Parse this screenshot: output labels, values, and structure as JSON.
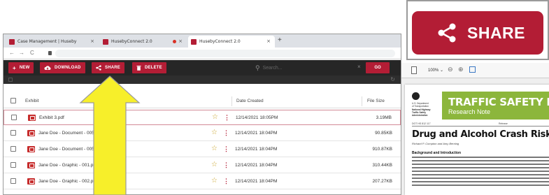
{
  "browser": {
    "tabs": [
      {
        "label": "Case Management | Huseby",
        "active": false
      },
      {
        "label": "HusebyConnect 2.0",
        "active": false
      },
      {
        "label": "HusebyConnect 2.0",
        "active": true
      }
    ],
    "new_tab_symbol": "+",
    "close_symbol": "×",
    "nav": {
      "back": "←",
      "forward": "→",
      "reload": "C"
    }
  },
  "toolbar": {
    "new_label": "NEW",
    "download_label": "DOWNLOAD",
    "share_label": "SHARE",
    "delete_label": "DELETE",
    "search_placeholder": "Search...",
    "go_label": "GO",
    "new_icon": "+",
    "download_icon": "cloud-download-icon",
    "share_icon": "share-icon",
    "delete_icon": "trash-icon"
  },
  "table": {
    "headers": {
      "exhibit": "Exhibit",
      "date": "Date Created",
      "size": "File Size"
    },
    "rows": [
      {
        "name": "Exhibit 3.pdf",
        "date": "12/14/2021 18:05PM",
        "size": "3.19MB",
        "highlighted": true
      },
      {
        "name": "Jane Doe - Document - 005",
        "date": "12/14/2021 18:04PM",
        "size": "90.85KB",
        "highlighted": false
      },
      {
        "name": "Jane Doe - Document - 005",
        "date": "12/14/2021 18:04PM",
        "size": "910.87KB",
        "highlighted": false
      },
      {
        "name": "Jane Doe - Graphic - 001.pdf",
        "date": "12/14/2021 18:04PM",
        "size": "310.44KB",
        "highlighted": false
      },
      {
        "name": "Jane Doe - Graphic - 002.pdf",
        "date": "12/14/2021 18:04PM",
        "size": "207.27KB",
        "highlighted": false
      }
    ],
    "star_symbol": "☆",
    "menu_symbol": "⋮"
  },
  "viewer": {
    "zoom": "100% ⌄",
    "minus": "⊖",
    "plus": "⊕",
    "page": {
      "agency_lines": [
        "U.S. Department",
        "of Transportation",
        "National Highway",
        "Traffic Safety",
        "Administration"
      ],
      "banner_title": "TRAFFIC SAFETY FACTS",
      "banner_subtitle": "Research Note",
      "doc_number": "DOT HS 812 117",
      "doc_meta": "Release",
      "title": "Drug and Alcohol Crash Risk",
      "authors": "Richard P. Compton and Amy Berning",
      "section": "Background and Introduction"
    }
  },
  "zoom_callout": {
    "label": "SHARE",
    "icon": "share-icon"
  },
  "annotation": {
    "arrow": "yellow-up-arrow"
  },
  "colors": {
    "accent": "#b31d35",
    "toolbar_bg": "#262626",
    "arrow_fill": "#f7ef2a",
    "banner_green": "#8cb63c"
  }
}
